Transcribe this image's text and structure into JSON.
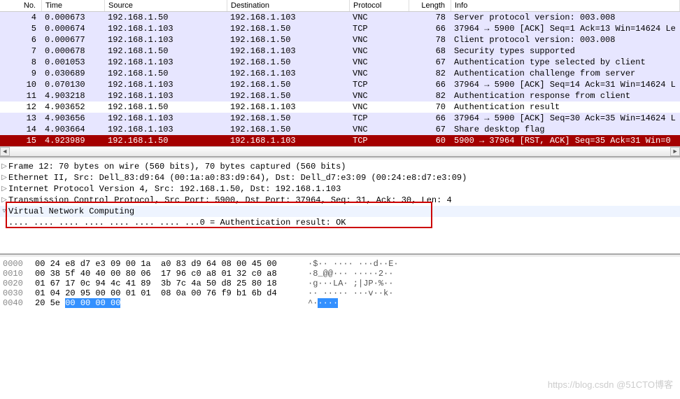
{
  "columns": {
    "no": "No.",
    "time": "Time",
    "src": "Source",
    "dst": "Destination",
    "proto": "Protocol",
    "len": "Length",
    "info": "Info"
  },
  "packets": [
    {
      "no": "4",
      "time": "0.000673",
      "src": "192.168.1.50",
      "dst": "192.168.1.103",
      "proto": "VNC",
      "len": "78",
      "info": "Server protocol version: 003.008",
      "cls": "normal"
    },
    {
      "no": "5",
      "time": "0.000674",
      "src": "192.168.1.103",
      "dst": "192.168.1.50",
      "proto": "TCP",
      "len": "66",
      "info": "37964 → 5900 [ACK] Seq=1 Ack=13 Win=14624 Le",
      "cls": "normal"
    },
    {
      "no": "6",
      "time": "0.000677",
      "src": "192.168.1.103",
      "dst": "192.168.1.50",
      "proto": "VNC",
      "len": "78",
      "info": "Client protocol version: 003.008",
      "cls": "normal"
    },
    {
      "no": "7",
      "time": "0.000678",
      "src": "192.168.1.50",
      "dst": "192.168.1.103",
      "proto": "VNC",
      "len": "68",
      "info": "Security types supported",
      "cls": "normal"
    },
    {
      "no": "8",
      "time": "0.001053",
      "src": "192.168.1.103",
      "dst": "192.168.1.50",
      "proto": "VNC",
      "len": "67",
      "info": "Authentication type selected by client",
      "cls": "normal"
    },
    {
      "no": "9",
      "time": "0.030689",
      "src": "192.168.1.50",
      "dst": "192.168.1.103",
      "proto": "VNC",
      "len": "82",
      "info": "Authentication challenge from server",
      "cls": "normal"
    },
    {
      "no": "10",
      "time": "0.070130",
      "src": "192.168.1.103",
      "dst": "192.168.1.50",
      "proto": "TCP",
      "len": "66",
      "info": "37964 → 5900 [ACK] Seq=14 Ack=31 Win=14624 L",
      "cls": "normal"
    },
    {
      "no": "11",
      "time": "4.903218",
      "src": "192.168.1.103",
      "dst": "192.168.1.50",
      "proto": "VNC",
      "len": "82",
      "info": "Authentication response from client",
      "cls": "normal"
    },
    {
      "no": "12",
      "time": "4.903652",
      "src": "192.168.1.50",
      "dst": "192.168.1.103",
      "proto": "VNC",
      "len": "70",
      "info": "Authentication result",
      "cls": "sel"
    },
    {
      "no": "13",
      "time": "4.903656",
      "src": "192.168.1.103",
      "dst": "192.168.1.50",
      "proto": "TCP",
      "len": "66",
      "info": "37964 → 5900 [ACK] Seq=30 Ack=35 Win=14624 L",
      "cls": "normal"
    },
    {
      "no": "14",
      "time": "4.903664",
      "src": "192.168.1.103",
      "dst": "192.168.1.50",
      "proto": "VNC",
      "len": "67",
      "info": "Share desktop flag",
      "cls": "normal"
    },
    {
      "no": "15",
      "time": "4.923989",
      "src": "192.168.1.50",
      "dst": "192.168.1.103",
      "proto": "TCP",
      "len": "60",
      "info": "5900 → 37964 [RST, ACK] Seq=35 Ack=31 Win=0",
      "cls": "last"
    }
  ],
  "details": [
    {
      "tw": "▷",
      "txt": "Frame 12: 70 bytes on wire (560 bits), 70 bytes captured (560 bits)",
      "hl": false
    },
    {
      "tw": "▷",
      "txt": "Ethernet II, Src: Dell_83:d9:64 (00:1a:a0:83:d9:64), Dst: Dell_d7:e3:09 (00:24:e8:d7:e3:09)",
      "hl": false
    },
    {
      "tw": "▷",
      "txt": "Internet Protocol Version 4, Src: 192.168.1.50, Dst: 192.168.1.103",
      "hl": false
    },
    {
      "tw": "▷",
      "txt": "Transmission Control Protocol, Src Port: 5900, Dst Port: 37964, Seq: 31, Ack: 30, Len: 4",
      "hl": false
    },
    {
      "tw": "▿",
      "txt": "Virtual Network Computing",
      "hl": true
    },
    {
      "tw": "",
      "txt": "   .... .... .... .... .... .... .... ...0 = Authentication result: OK",
      "hl": false
    }
  ],
  "hex": [
    {
      "off": "0000",
      "b": "00 24 e8 d7 e3 09 00 1a  a0 83 d9 64 08 00 45 00",
      "a": "·$·· ···· ···d··E·"
    },
    {
      "off": "0010",
      "b": "00 38 5f 40 40 00 80 06  17 96 c0 a8 01 32 c0 a8",
      "a": "·8_@@··· ·····2··"
    },
    {
      "off": "0020",
      "b": "01 67 17 0c 94 4c 41 89  3b 7c 4a 50 d8 25 80 18",
      "a": "·g···LA· ;|JP·%··"
    },
    {
      "off": "0030",
      "b": "01 04 20 95 00 00 01 01  08 0a 00 76 f9 b1 6b d4",
      "a": "·· ····· ···v··k·"
    },
    {
      "off": "0040",
      "b": "20 5e ",
      "a": "^·",
      "selB": "00 00 00 00",
      "selA": "····"
    }
  ],
  "watermark": "https://blog.csdn  @51CTO博客"
}
